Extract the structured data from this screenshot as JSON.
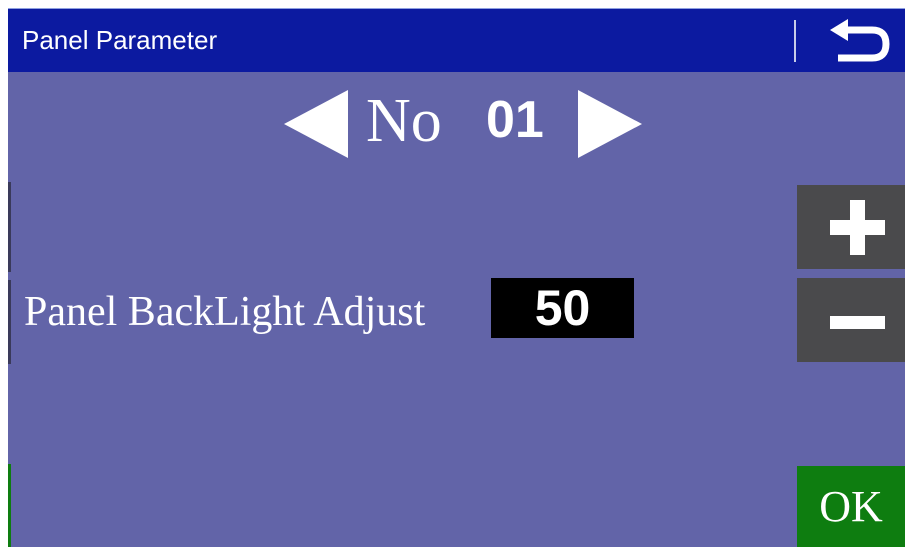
{
  "title": "Panel Parameter",
  "icons": {
    "back": "back-arrow-icon",
    "prev": "triangle-left-icon",
    "next": "triangle-right-icon",
    "plus": "plus-icon",
    "minus": "minus-icon"
  },
  "navigator": {
    "prefix": "No",
    "number": "01"
  },
  "parameter": {
    "label": "Panel BackLight Adjust",
    "value": "50"
  },
  "ok_label": "OK",
  "colors": {
    "background": "#6264a8",
    "title_bar": "#0c1aa0",
    "side_button": "#4a4a4c",
    "ok_button": "#0e7d10",
    "value_box": "#000000"
  }
}
